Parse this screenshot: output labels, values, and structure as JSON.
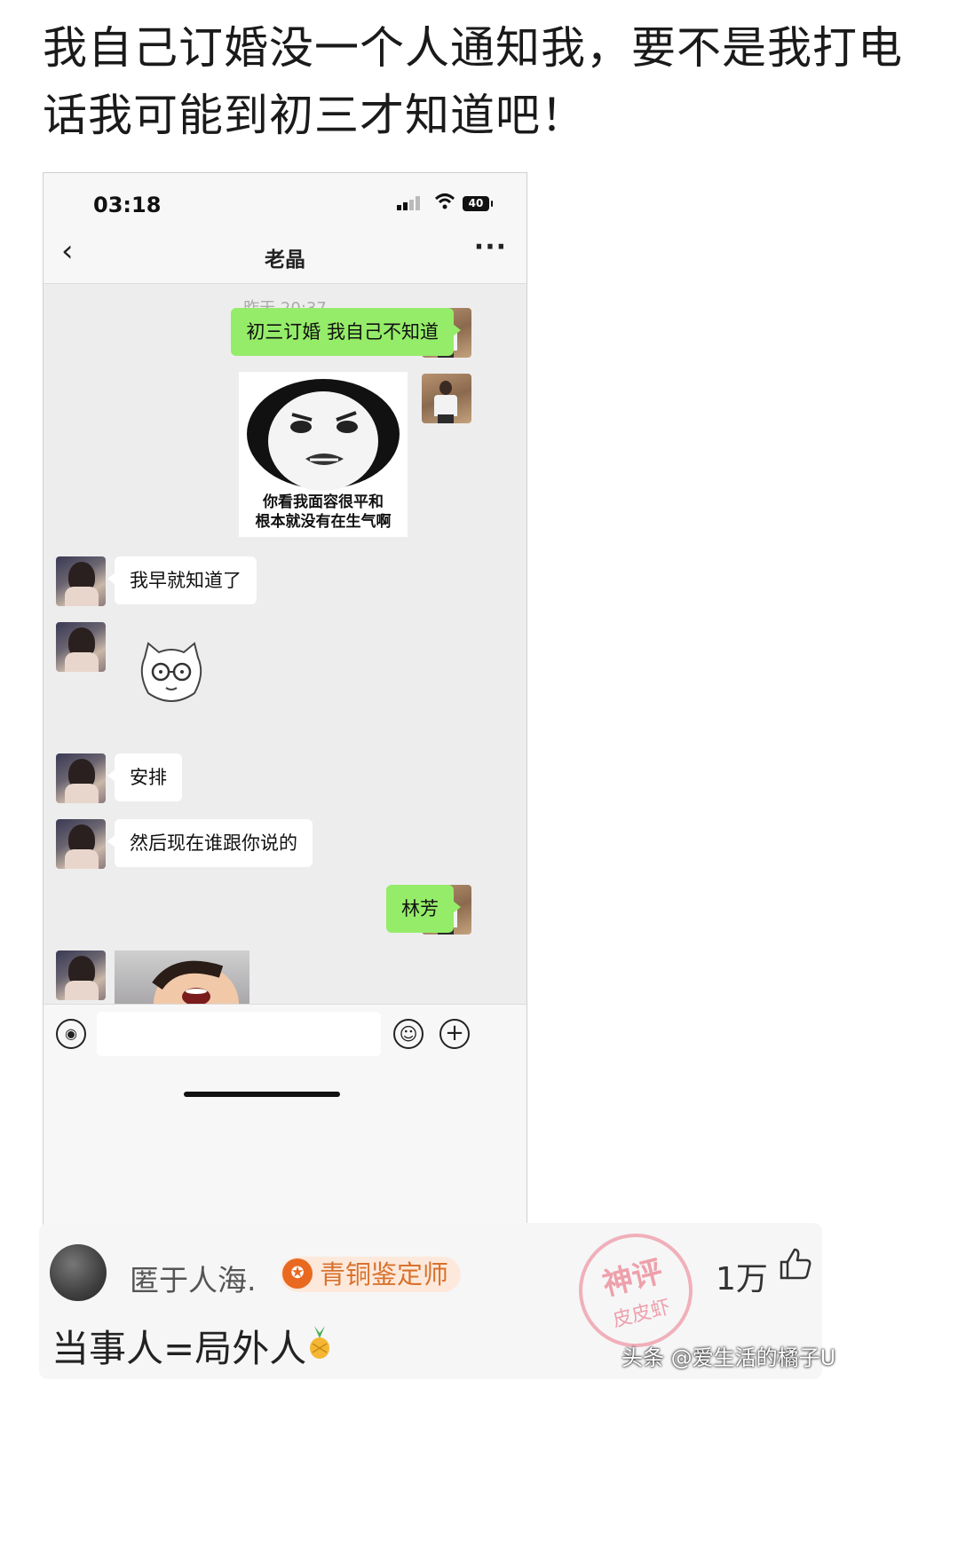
{
  "post": {
    "title": "我自己订婚没一个人通知我，要不是我打电话我可能到初三才知道吧！"
  },
  "phone": {
    "status": {
      "time": "03:18",
      "battery": "40"
    },
    "nav": {
      "back_icon": "chevron-left-icon",
      "title": "老晶",
      "more_icon": "more-dots-icon"
    },
    "timestamp": "昨天 20:37",
    "messages": [
      {
        "from": "me",
        "type": "text",
        "text": "初三订婚 我自己不知道"
      },
      {
        "from": "me",
        "type": "sticker",
        "caption_line1": "你看我面容很平和",
        "caption_line2": "根本就没有在生气啊"
      },
      {
        "from": "them",
        "type": "text",
        "text": "我早就知道了"
      },
      {
        "from": "them",
        "type": "sticker",
        "icon": "glasses-cat-sticker"
      },
      {
        "from": "them",
        "type": "text",
        "text": "安排"
      },
      {
        "from": "them",
        "type": "text",
        "text": "然后现在谁跟你说的"
      },
      {
        "from": "me",
        "type": "text",
        "text": "林芳"
      },
      {
        "from": "them",
        "type": "image",
        "icon": "laughing-kid-photo"
      }
    ],
    "input_bar": {
      "voice_icon": "voice-icon",
      "emoji_icon": "emoji-icon",
      "plus_icon": "plus-icon"
    }
  },
  "comment": {
    "username": "匿于人海.",
    "badge": "青铜鉴定师",
    "stamp_line1": "神评",
    "stamp_line2": "皮皮虾",
    "likes": "1万",
    "like_icon": "thumbs-up-icon",
    "text": "当事人=局外人",
    "text_emoji": "pineapple-emoji"
  },
  "watermark": "头条 @爱生活的橘子U"
}
